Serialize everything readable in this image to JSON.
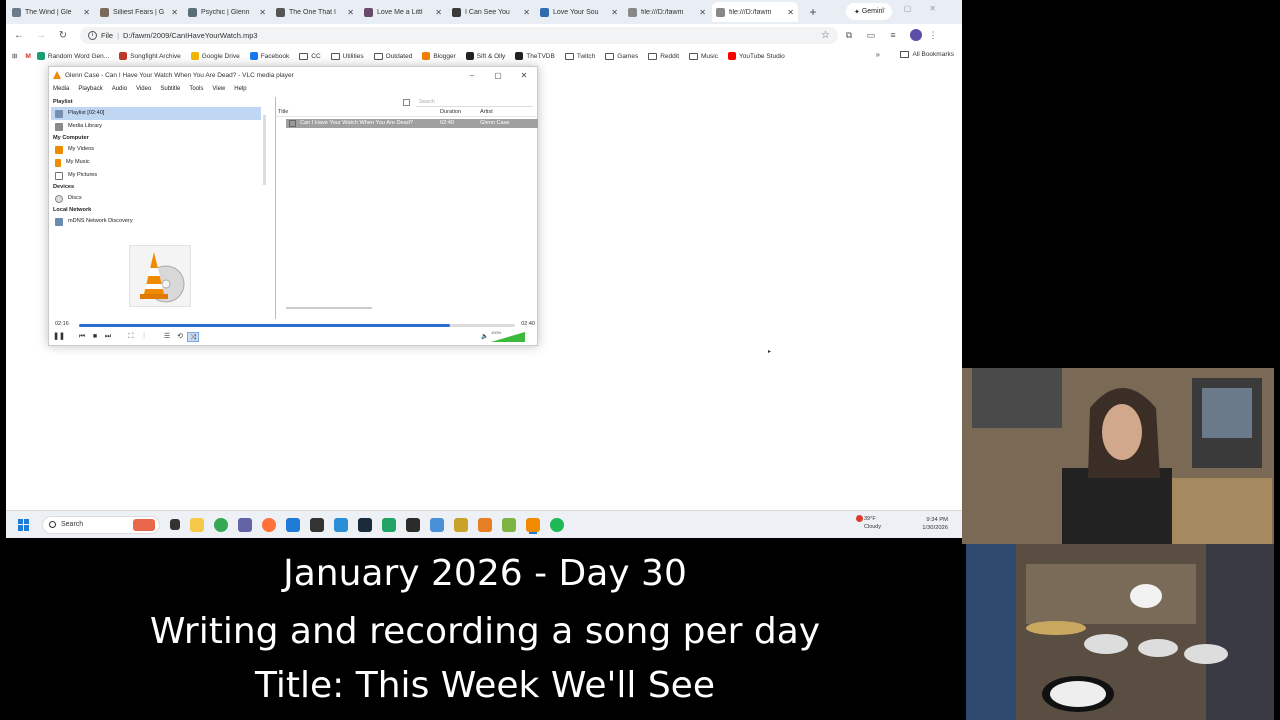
{
  "browser": {
    "tabs": [
      {
        "label": "The Wind | Gle",
        "color": "#6b7b8c"
      },
      {
        "label": "Silliest Fears | G",
        "color": "#7a6a5a"
      },
      {
        "label": "Psychic | Glenn",
        "color": "#5a6e7a"
      },
      {
        "label": "The One That I",
        "color": "#555555"
      },
      {
        "label": "Love Me a Littl",
        "color": "#6a4a6a"
      },
      {
        "label": "I Can See You",
        "color": "#3a3a3a"
      },
      {
        "label": "Love Your Sou",
        "color": "#2f6db0"
      },
      {
        "label": "file:///D:/fawm",
        "color": "#888888"
      },
      {
        "label": "file:///D:/fawm",
        "color": "#888888"
      }
    ],
    "gemini_label": "Gemini",
    "address": {
      "scheme_label": "File",
      "url": "D:/fawm/2009/CanIHaveYourWatch.mp3"
    },
    "bookmarks": [
      {
        "label": "Random Word Gen...",
        "type": "site",
        "color": "#1b9e77"
      },
      {
        "label": "Songfight Archive",
        "type": "site",
        "color": "#c0392b"
      },
      {
        "label": "Google Drive",
        "type": "site",
        "color": "#f4b400"
      },
      {
        "label": "Facebook",
        "type": "site",
        "color": "#1877f2"
      },
      {
        "label": "CC",
        "type": "folder"
      },
      {
        "label": "Utilities",
        "type": "folder"
      },
      {
        "label": "Outdated",
        "type": "folder"
      },
      {
        "label": "Blogger",
        "type": "site",
        "color": "#f57d00"
      },
      {
        "label": "Sift & Olly",
        "type": "site",
        "color": "#222222"
      },
      {
        "label": "TheTVDB",
        "type": "site",
        "color": "#222222"
      },
      {
        "label": "Twitch",
        "type": "folder"
      },
      {
        "label": "Games",
        "type": "folder"
      },
      {
        "label": "Reddit",
        "type": "folder"
      },
      {
        "label": "Music",
        "type": "folder"
      },
      {
        "label": "YouTube Studio",
        "type": "site",
        "color": "#ff0000"
      }
    ],
    "all_bookmarks_label": "All Bookmarks"
  },
  "vlc": {
    "title": "Glenn Case - Can I Have Your Watch When You Are Dead? - VLC media player",
    "menu": [
      "Media",
      "Playback",
      "Audio",
      "Video",
      "Subtitle",
      "Tools",
      "View",
      "Help"
    ],
    "sidebar": {
      "playlist_header": "Playlist",
      "playlist_items": [
        {
          "label": "Playlist [02:40]",
          "selected": true,
          "color": "#7a8fb0"
        },
        {
          "label": "Media Library",
          "selected": false,
          "color": "#8a8a8a"
        }
      ],
      "computer_header": "My Computer",
      "computer_items": [
        {
          "label": "My Videos",
          "color": "#f08a00"
        },
        {
          "label": "My Music",
          "color": "#f08a00"
        },
        {
          "label": "My Pictures",
          "color": "#7a7a7a"
        }
      ],
      "devices_header": "Devices",
      "devices_items": [
        {
          "label": "Discs",
          "color": "#9a9a9a"
        }
      ],
      "network_header": "Local Network",
      "network_items": [
        {
          "label": "mDNS Network Discovery",
          "color": "#6a8ab0"
        }
      ]
    },
    "search_placeholder": "Search",
    "columns": {
      "title": "Title",
      "duration": "Duration",
      "artist": "Artist"
    },
    "rows": [
      {
        "title": "Can I Have Your Watch When You Are Dead?",
        "duration": "02:40",
        "artist": "Glenn Case"
      }
    ],
    "elapsed": "02:16",
    "total": "02:40",
    "progress": 0.85,
    "volume_label": "100%",
    "volume": 1.0
  },
  "taskbar": {
    "search_label": "Search",
    "weather_temp": "39°F",
    "weather_desc": "Cloudy",
    "time": "9:34 PM",
    "date": "1/30/2026",
    "apps": [
      {
        "name": "file-explorer-app",
        "color": "#f7c948"
      },
      {
        "name": "chrome-app",
        "color": "#34a853"
      },
      {
        "name": "teams-app",
        "color": "#6264a7"
      },
      {
        "name": "firefox-app",
        "color": "#ff7139"
      },
      {
        "name": "store-app",
        "color": "#1f7ad8"
      },
      {
        "name": "app-dark-1",
        "color": "#333333"
      },
      {
        "name": "app-blue-2",
        "color": "#2a8fd6"
      },
      {
        "name": "terminal-app",
        "color": "#1b2b3b"
      },
      {
        "name": "excel-app",
        "color": "#21a366"
      },
      {
        "name": "app-dark-3",
        "color": "#2b2b2b"
      },
      {
        "name": "app-blue-4",
        "color": "#4a90d9"
      },
      {
        "name": "app-check-5",
        "color": "#c9a227"
      },
      {
        "name": "app-orange-6",
        "color": "#e67e22"
      },
      {
        "name": "app-green-7",
        "color": "#7cb342"
      },
      {
        "name": "vlc-app",
        "color": "#f08a00"
      },
      {
        "name": "spotify-app",
        "color": "#1db954"
      }
    ]
  },
  "captions": {
    "line1": "January 2026 - Day 30",
    "line2": "Writing and recording a song per day",
    "line3": "Title: This Week We'll See"
  }
}
